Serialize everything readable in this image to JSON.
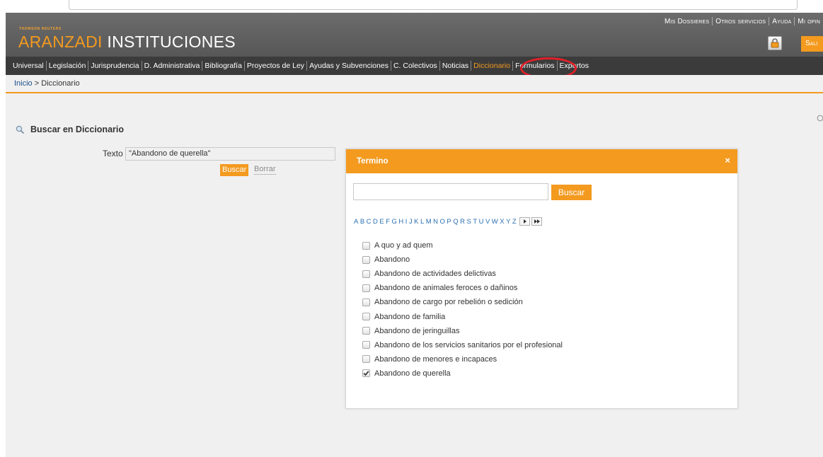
{
  "header": {
    "brand_small": "THOMSON REUTERS",
    "brand_accent": "ARANZADI",
    "brand_main": " INSTITUCIONES",
    "top_links": [
      "Mis Dossieres",
      "Otros servicios",
      "Ayuda",
      "Mi opin"
    ],
    "logout_label": "Sali"
  },
  "nav": {
    "items": [
      "Universal",
      "Legislación",
      "Jurisprudencia",
      "D. Administrativa",
      "Bibliografía",
      "Proyectos de Ley",
      "Ayudas y Subvenciones",
      "C. Colectivos",
      "Noticias",
      "Diccionario",
      "Formularios",
      "Expertos"
    ],
    "active": "Diccionario"
  },
  "breadcrumb": {
    "home": "Inicio",
    "separator": " > ",
    "current": "Diccionario"
  },
  "search": {
    "heading": "Buscar en Diccionario",
    "texto_label": "Texto",
    "texto_value": "\"Abandono de querella\"",
    "buscar_label": "Buscar",
    "borrar_label": "Borrar"
  },
  "dialog": {
    "title": "Termino",
    "close_glyph": "×",
    "input_value": "",
    "buscar_label": "Buscar",
    "alphabet": [
      "A",
      "B",
      "C",
      "D",
      "E",
      "F",
      "G",
      "H",
      "I",
      "J",
      "K",
      "L",
      "M",
      "N",
      "O",
      "P",
      "Q",
      "R",
      "S",
      "T",
      "U",
      "V",
      "W",
      "X",
      "Y",
      "Z"
    ],
    "terms": [
      {
        "label": "A quo y ad quem",
        "checked": false
      },
      {
        "label": "Abandono",
        "checked": false
      },
      {
        "label": "Abandono de actividades delictivas",
        "checked": false
      },
      {
        "label": "Abandono de animales feroces o dañinos",
        "checked": false
      },
      {
        "label": "Abandono de cargo por rebelión o sedición",
        "checked": false
      },
      {
        "label": "Abandono de familia",
        "checked": false
      },
      {
        "label": "Abandono de jeringuillas",
        "checked": false
      },
      {
        "label": "Abandono de los servicios sanitarios por el profesional",
        "checked": false
      },
      {
        "label": "Abandono de menores e incapaces",
        "checked": false
      },
      {
        "label": "Abandono de querella",
        "checked": true
      }
    ]
  },
  "colors": {
    "accent": "#f39a1f",
    "header_bg": "#5f5f5f",
    "nav_bg": "#3b3b3b",
    "annotation": "#e0202a"
  }
}
